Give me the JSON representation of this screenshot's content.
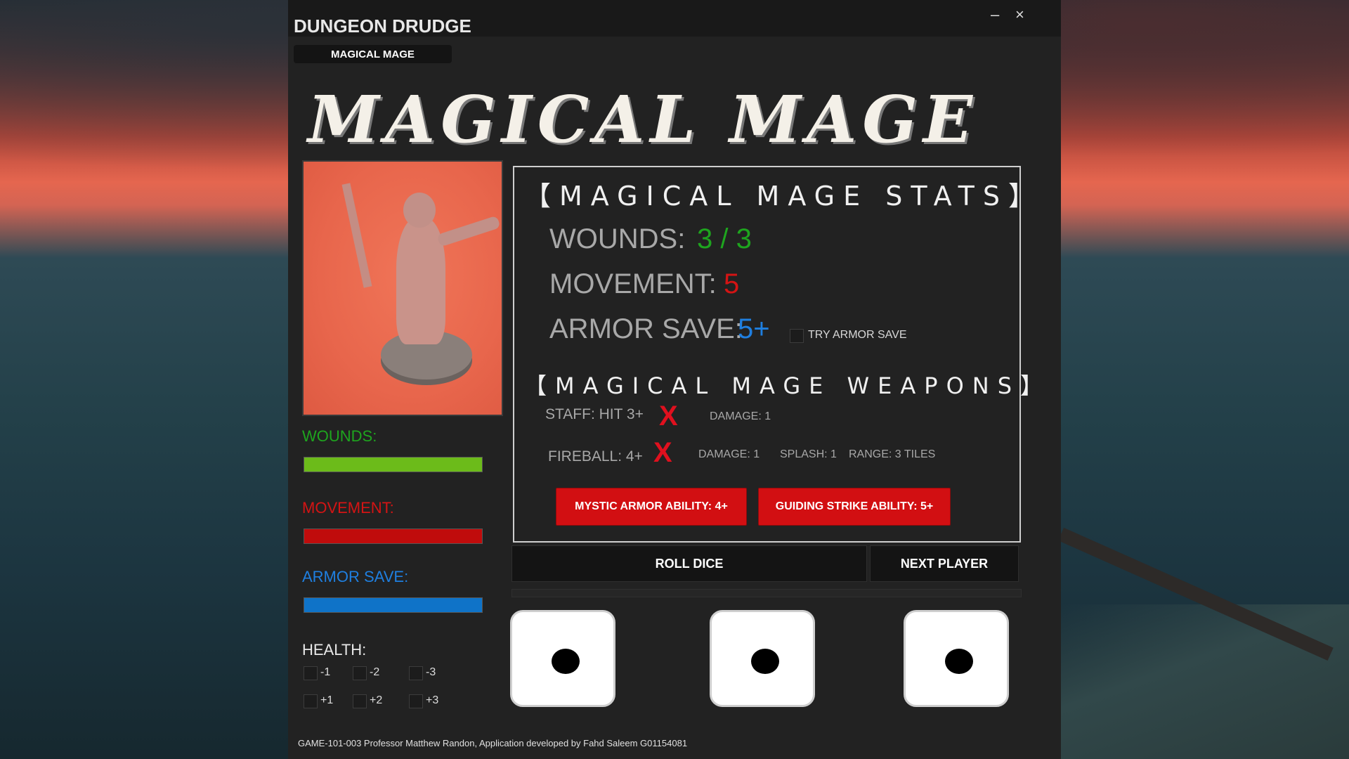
{
  "window": {
    "title": "DUNGEON DRUDGE",
    "minimize_label": "–",
    "close_label": "×",
    "tab_label": "MAGICAL MAGE"
  },
  "hero_title": "MAGICAL MAGE",
  "left": {
    "wounds_label": "WOUNDS:",
    "movement_label": "MOVEMENT:",
    "armor_save_label": "ARMOR SAVE:",
    "wounds_fill": 1.0,
    "movement_fill": 1.0,
    "armor_fill": 1.0,
    "health_title": "HEALTH:",
    "health_options": [
      "-1",
      "-2",
      "-3",
      "+1",
      "+2",
      "+3"
    ]
  },
  "stats": {
    "heading": "【MAGICAL MAGE STATS】",
    "wounds_label": "WOUNDS:",
    "wounds_value": "3 / 3",
    "movement_label": "MOVEMENT:",
    "movement_value": "5",
    "armor_label": "ARMOR SAVE:",
    "armor_value": "5+",
    "try_armor_label": "TRY ARMOR SAVE"
  },
  "weapons": {
    "heading": "【MAGICAL MAGE WEAPONS】",
    "staff_label": "STAFF: HIT 3+",
    "staff_damage": "DAMAGE: 1",
    "fireball_label": "FIREBALL: 4+",
    "fireball_damage": "DAMAGE: 1",
    "fireball_splash": "SPLASH: 1",
    "fireball_range": "RANGE: 3 TILES",
    "x_mark": "X"
  },
  "abilities": {
    "mystic_armor": "MYSTIC ARMOR ABILITY: 4+",
    "guiding_strike": "GUIDING STRIKE ABILITY: 5+"
  },
  "actions": {
    "roll_dice": "ROLL DICE",
    "next_player": "NEXT PLAYER"
  },
  "dice": [
    1,
    1,
    1
  ],
  "footer": "GAME-101-003 Professor Matthew Randon, Application developed by Fahd Saleem G01154081",
  "colors": {
    "wounds": "#1ea51e",
    "movement": "#d41414",
    "armor": "#1f7fe0",
    "wounds_bar": "#6cbb1a",
    "movement_bar": "#c00c0c",
    "armor_bar": "#0f73c8",
    "accent_red": "#d20f12"
  }
}
